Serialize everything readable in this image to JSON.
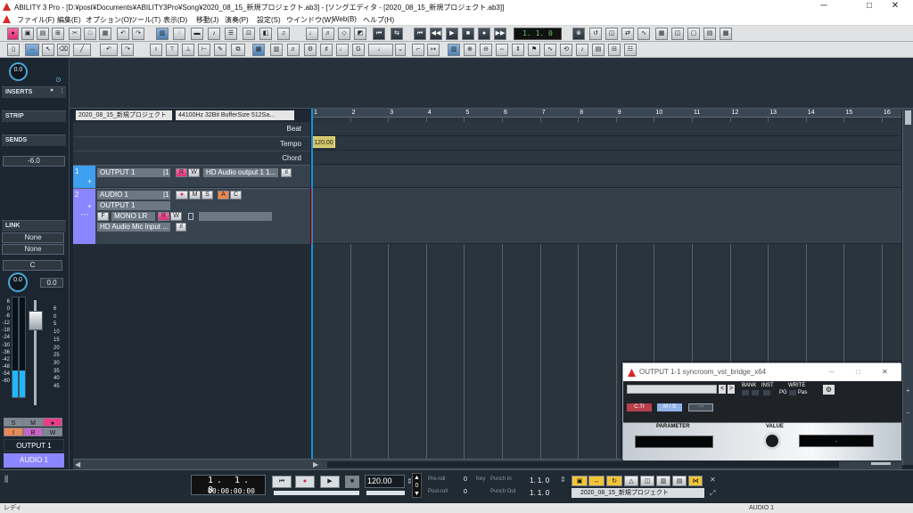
{
  "window": {
    "title": "ABILITY 3 Pro - [D:¥post¥Documents¥ABILITY3Pro¥Song¥2020_08_15_新規プロジェクト.ab3] - [ソングエディタ - [2020_08_15_新規プロジェクト.ab3]]",
    "minimize": "─",
    "restore": "□",
    "close": "✕"
  },
  "menu": [
    "ファイル(F)",
    "編集(E)",
    "オプション(O)",
    "ツール(T)",
    "表示(D)",
    "移動(J)",
    "演奏(P)",
    "設定(S)",
    "ウインドウ(W)",
    "Web(B)",
    "ヘルプ(H)"
  ],
  "toolbar": {
    "counter": "1. 1. 0"
  },
  "inspector": {
    "knob_value": "0.0",
    "inserts": "INSERTS",
    "strip": "STRIP",
    "sends": "SENDS",
    "send_value": "-6.0",
    "link": "LINK",
    "none_1": "None",
    "none_2": "None",
    "c_symbol": "C",
    "pan_value": "0.0",
    "fader_value": "0.0",
    "scale_left": [
      "6",
      "0",
      "-6",
      "-12",
      "-18",
      "-24",
      "-30",
      "-36",
      "-42",
      "-48",
      "-54",
      "-60"
    ],
    "scale_right": [
      "6",
      "0",
      "5",
      "10",
      "15",
      "20",
      "25",
      "30",
      "35",
      "40",
      "45"
    ],
    "s_label": "S",
    "m_label": "M",
    "i_label": "I",
    "r_label": "R",
    "w_label": "W",
    "output_name": "OUTPUT 1",
    "track_name": "AUDIO 1"
  },
  "song": {
    "project_name": "2020_08_15_新規プロジェクト",
    "audio_format": "44100Hz 32Bit BufferSize 512Sa...",
    "rows": [
      "Beat",
      "Tempo",
      "Chord"
    ],
    "tempo": "120.00",
    "ruler": [
      "1",
      "2",
      "3",
      "4",
      "5",
      "6",
      "7",
      "8",
      "9",
      "10",
      "11",
      "12",
      "13",
      "14",
      "15",
      "16"
    ]
  },
  "tracks": [
    {
      "number": "1",
      "name": "OUTPUT 1",
      "channel": "|1",
      "r": "R",
      "w": "W",
      "device": "HD Audio output 1 1...",
      "indicator": "ıl",
      "plus": "+"
    },
    {
      "number": "2",
      "name": "AUDIO 1",
      "channel": "|1",
      "record": "●",
      "m": "M",
      "s": "S",
      "a": "A",
      "c": "C",
      "output": "OUTPUT 1",
      "f": "F",
      "mono": "MONO LR",
      "r": "R",
      "w": "W",
      "input": "HD Audio Mic input ...",
      "indicator": "ıl",
      "plus": "+"
    }
  ],
  "transport": {
    "time_top": "1. 1. 0",
    "time_bottom": "00:00:00:00",
    "tempo": "120.00",
    "preroll": "Pre-roll",
    "postroll": "Post-roll",
    "preroll_value": "0",
    "postroll_value": "0",
    "key": "Key",
    "punch_in": "Punch In",
    "punch_out": "Punch Out",
    "punch_in_value": "1. 1. 0",
    "punch_out_value": "1. 1. 0",
    "project_name": "2020_08_15_新規プロジェクト"
  },
  "plugin": {
    "title": "OUTPUT 1-1 syncroom_vst_bridge_x64",
    "bank": "BANK",
    "inst": "INST",
    "write": "WRITE",
    "pg": "PG",
    "pas": "Pas",
    "ctr": "C.Tr",
    "ms": "M / S",
    "parameter": "PARAMETER",
    "value": "VALUE",
    "dot": "."
  },
  "status": {
    "left": "レディ",
    "right": "AUDIO 1"
  }
}
